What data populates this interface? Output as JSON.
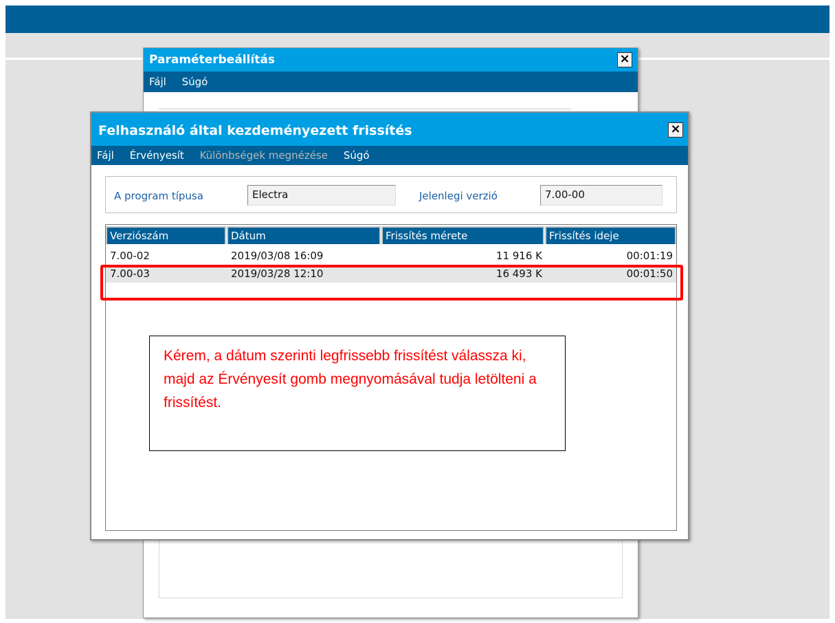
{
  "back_window": {
    "title": "Paraméterbeállítás",
    "close_label": "×",
    "menu": [
      "Fájl",
      "Súgó"
    ]
  },
  "dialog": {
    "title": "Felhasználó által kezdeményezett frissítés",
    "close_label": "×",
    "menu": {
      "file": "Fájl",
      "apply": "Érvényesít",
      "diff": "Különbségek megnézése",
      "help": "Súgó"
    },
    "program_type_label": "A program típusa",
    "program_type_value": "Electra",
    "current_version_label": "Jelenlegi verzió",
    "current_version_value": "7.00-00",
    "columns": [
      "Verziószám",
      "Dátum",
      "Frissítés mérete",
      "Frissítés ideje"
    ],
    "rows": [
      {
        "version": "7.00-02",
        "date": "2019/03/08 16:09",
        "size": "11 916 K",
        "time": "00:01:19",
        "selected": false
      },
      {
        "version": "7.00-03",
        "date": "2019/03/28 12:10",
        "size": "16 493 K",
        "time": "00:01:50",
        "selected": true
      }
    ]
  },
  "annotation": {
    "text": "Kérem, a dátum szerinti legfrissebb frissítést válassza ki, majd az Érvényesít gomb megnyomásával tudja letölteni a frissítést."
  },
  "colors": {
    "title_bar": "#009fe3",
    "menu_bar": "#005f96",
    "highlight": "#ff0000"
  }
}
